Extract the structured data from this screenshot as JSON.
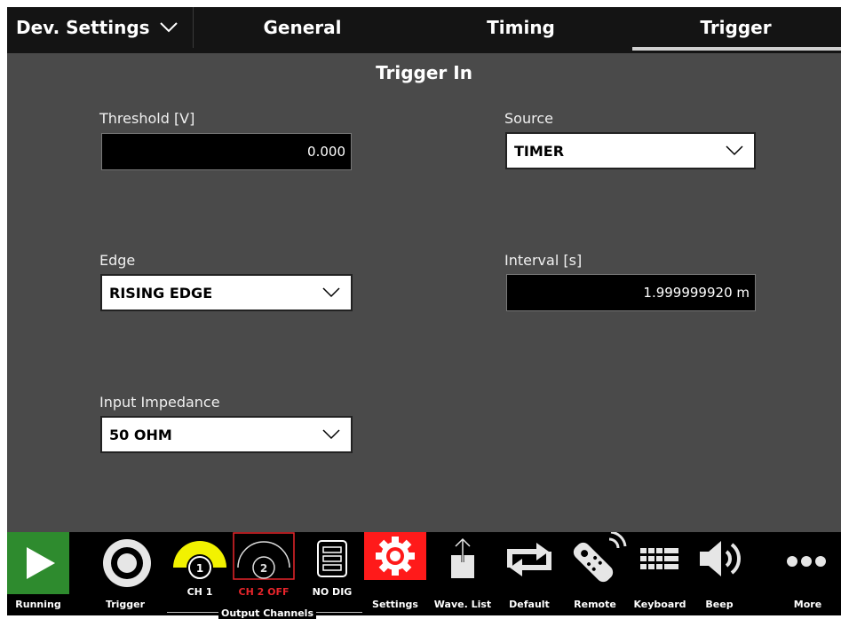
{
  "topbar": {
    "dev_settings_label": "Dev. Settings",
    "tabs": [
      {
        "label": "General"
      },
      {
        "label": "Timing"
      },
      {
        "label": "Trigger"
      }
    ]
  },
  "main": {
    "section_title": "Trigger In",
    "threshold": {
      "label": "Threshold [V]",
      "value": "0.000"
    },
    "source": {
      "label": "Source",
      "value": "TIMER"
    },
    "edge": {
      "label": "Edge",
      "value": "RISING EDGE"
    },
    "interval": {
      "label": "Interval [s]",
      "value": "1.999999920 m"
    },
    "impedance": {
      "label": "Input Impedance",
      "value": "50 OHM"
    }
  },
  "toolbar": {
    "running": "Running",
    "trigger": "Trigger",
    "ch1": "CH 1",
    "ch2": "CH 2 OFF",
    "nodig": "NO DIG",
    "output_channels": "Output Channels",
    "settings": "Settings",
    "wave_list": "Wave. List",
    "default": "Default",
    "remote": "Remote",
    "keyboard": "Keyboard",
    "beep": "Beep",
    "more": "More",
    "ch1_number": "1",
    "ch2_number": "2"
  },
  "colors": {
    "running_green": "#2e8b2e",
    "settings_red": "#ff1a1a",
    "ch1_yellow": "#f2f200",
    "ch2_off_red": "#e8252b"
  }
}
